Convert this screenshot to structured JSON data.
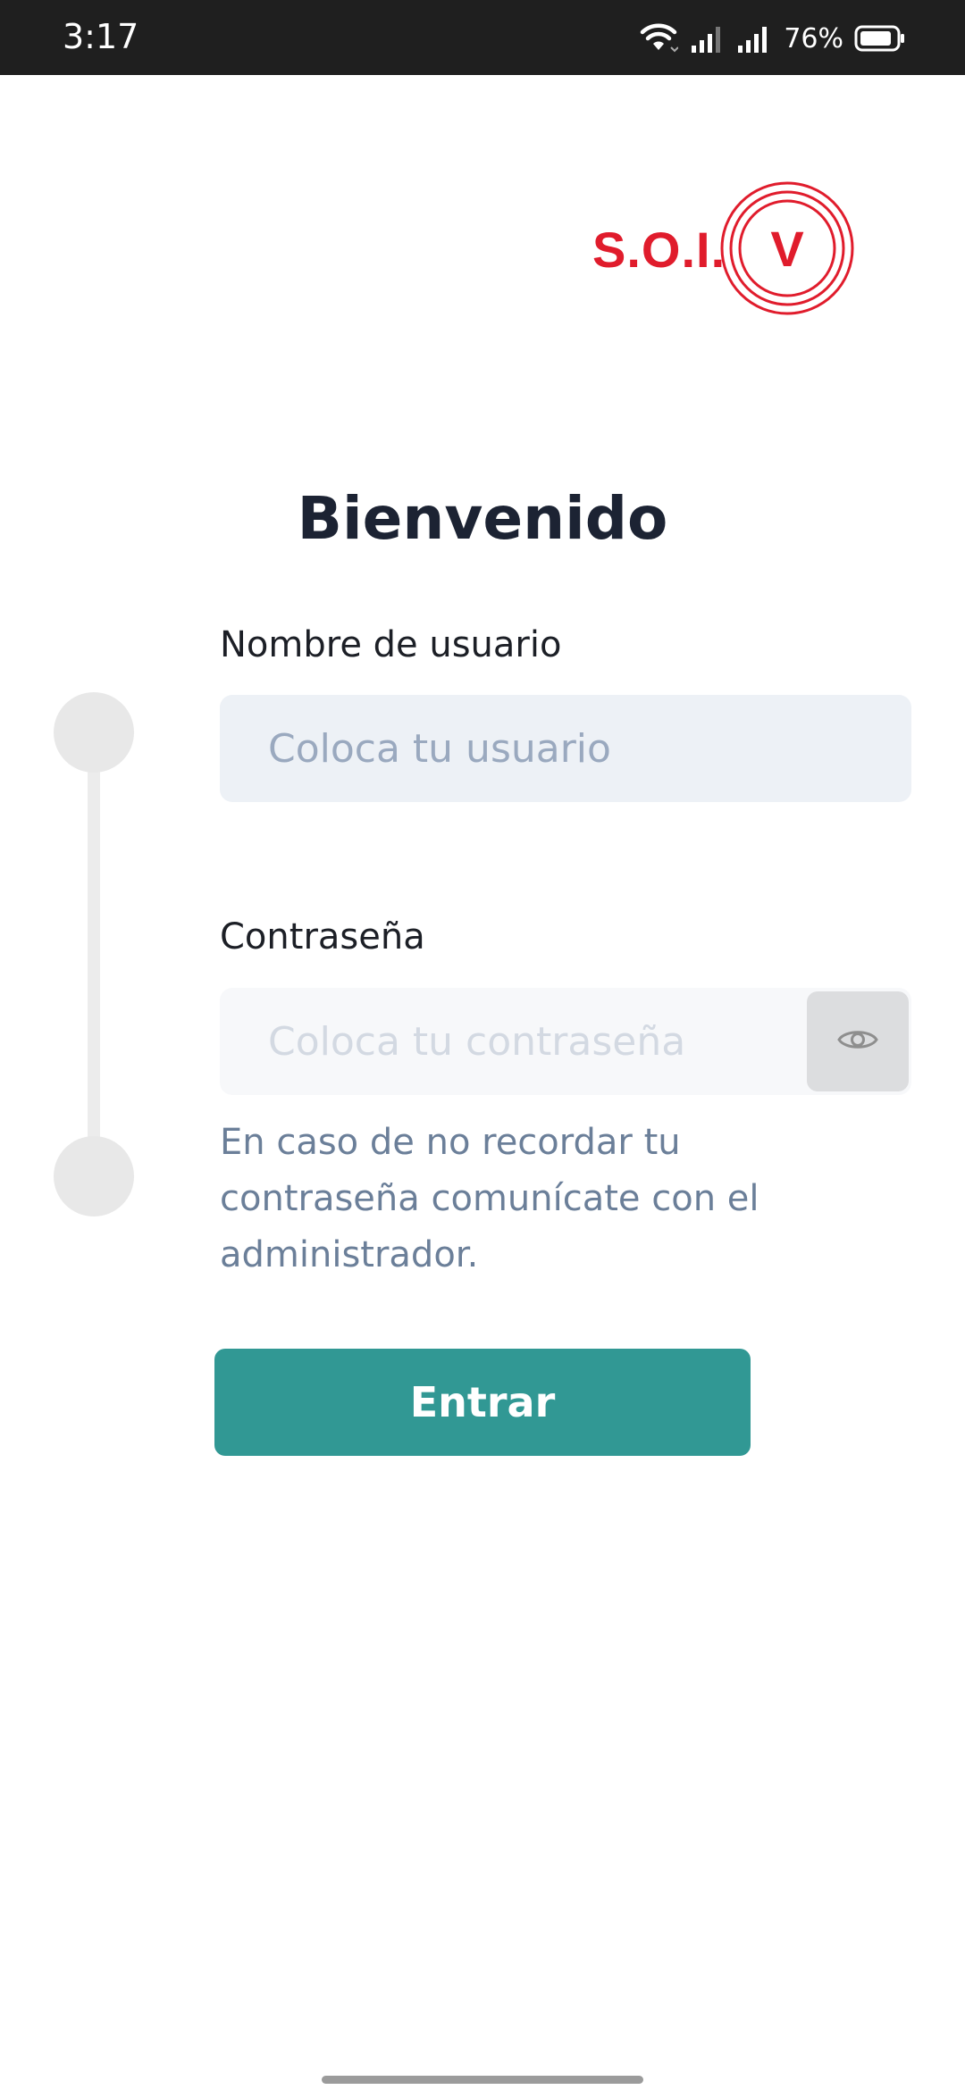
{
  "status_bar": {
    "time": "3:17",
    "battery_percent": "76%",
    "icons": [
      "wifi-icon",
      "signal-icon",
      "signal-icon",
      "battery-icon"
    ]
  },
  "logo": {
    "text": "S.O.I.",
    "seal_letter": "V",
    "color": "#e01c2c"
  },
  "login": {
    "title": "Bienvenido",
    "username": {
      "label": "Nombre de usuario",
      "placeholder": "Coloca tu usuario",
      "value": ""
    },
    "password": {
      "label": "Contraseña",
      "placeholder": "Coloca tu contraseña",
      "value": "",
      "toggle_icon": "eye-icon"
    },
    "helper": "En caso de no recordar tu contraseña comunícate con el administrador.",
    "submit_label": "Entrar",
    "submit_color": "#319894"
  }
}
